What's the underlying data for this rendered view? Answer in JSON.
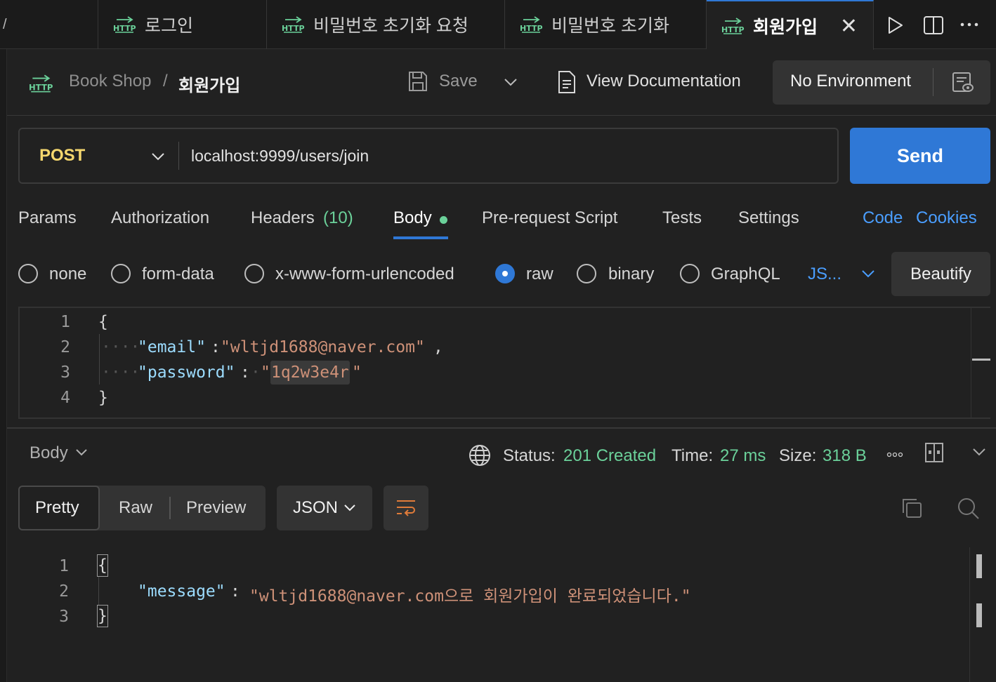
{
  "tabs": [
    {
      "label": "로그인"
    },
    {
      "label": "비밀번호 초기화 요청"
    },
    {
      "label": "비밀번호 초기화"
    },
    {
      "label": "회원가입",
      "active": true
    }
  ],
  "http_badge": "HTTP",
  "breadcrumb": {
    "collection": "Book Shop",
    "separator": "/",
    "request": "회원가입"
  },
  "header": {
    "save_label": "Save",
    "docs_label": "View Documentation",
    "environment": "No Environment"
  },
  "request": {
    "method": "POST",
    "url": "localhost:9999/users/join",
    "send_label": "Send"
  },
  "request_tabs": {
    "params": "Params",
    "authorization": "Authorization",
    "headers": "Headers",
    "headers_count": "(10)",
    "body": "Body",
    "pre_request": "Pre-request Script",
    "tests": "Tests",
    "settings": "Settings",
    "code": "Code",
    "cookies": "Cookies"
  },
  "body_types": {
    "none": "none",
    "form_data": "form-data",
    "urlencoded": "x-www-form-urlencoded",
    "raw": "raw",
    "binary": "binary",
    "graphql": "GraphQL",
    "language": "JS...",
    "beautify": "Beautify",
    "selected": "raw"
  },
  "request_body": {
    "line_numbers": [
      "1",
      "2",
      "3",
      "4"
    ],
    "open_brace": "{",
    "close_brace": "}",
    "email_key": "\"email\"",
    "email_value": "\"wltjd1688@naver.com\"",
    "password_key": "\"password\"",
    "password_value_open": "\"",
    "password_value": "1q2w3e4r",
    "password_value_close": "\""
  },
  "response": {
    "body_label": "Body",
    "status_label": "Status:",
    "status_value": "201 Created",
    "time_label": "Time:",
    "time_value": "27 ms",
    "size_label": "Size:",
    "size_value": "318 B",
    "view_tabs": {
      "pretty": "Pretty",
      "raw": "Raw",
      "preview": "Preview"
    },
    "format": "JSON",
    "line_numbers": [
      "1",
      "2",
      "3"
    ],
    "open_brace": "{",
    "close_brace": "}",
    "message_key": "\"message\"",
    "message_value": "\"wltjd1688@naver.com으로 회원가입이 완료되었습니다.\""
  },
  "colors": {
    "accent": "#2f78d6",
    "success": "#6bd19a",
    "method": "#f5d76e",
    "string": "#ce9178",
    "key": "#9cdcfe"
  }
}
